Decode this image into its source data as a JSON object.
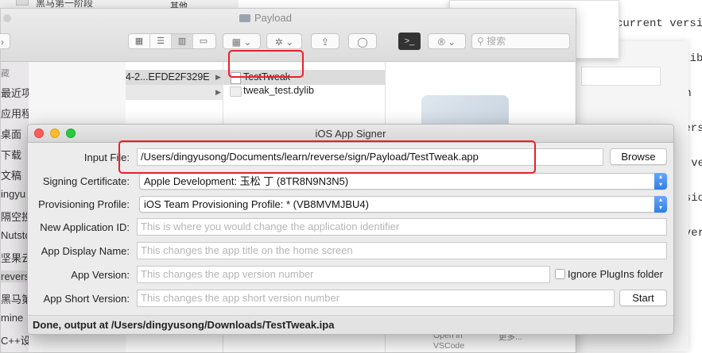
{
  "background": {
    "doc_lines": [
      "current versi",
      "mpatib",
      "tion",
      "versi",
      "nt ver",
      "ersio",
      "t ver"
    ],
    "vscode_open": "Open in",
    "vscode_name": "VSCode",
    "vscode_more": "更多..."
  },
  "top_strip": {
    "item1": "黑马第一阶段",
    "item2": "其他"
  },
  "finder": {
    "title": "Payload",
    "search_placeholder": "搜索",
    "sidebar_items": [
      "藏",
      "最近项目",
      "应用程序",
      "桌面",
      "下载",
      "文稿",
      "ingyu",
      "隔空投",
      "Nutsto",
      "坚果云",
      "reverse",
      "黑马第",
      "mine",
      "C++设计模式"
    ],
    "col1_item": "4-2...EFDE2F329E",
    "col2_items": [
      "TestTweak",
      "tweak_test.dylib"
    ]
  },
  "signer": {
    "title": "iOS App Signer",
    "input_file_label": "Input File:",
    "input_file_value": "/Users/dingyusong/Documents/learn/reverse/sign/Payload/TestTweak.app",
    "browse_label": "Browse",
    "signing_cert_label": "Signing Certificate:",
    "signing_cert_value": "Apple Development: 玉松 丁 (8TR8N9N3N5)",
    "prov_profile_label": "Provisioning Profile:",
    "prov_profile_value": "iOS Team Provisioning Profile: * (VB8MVMJBU4)",
    "new_app_id_label": "New Application ID:",
    "new_app_id_placeholder": "This is where you would change the application identifier",
    "display_name_label": "App Display Name:",
    "display_name_placeholder": "This changes the app title on the home screen",
    "app_version_label": "App Version:",
    "app_version_placeholder": "This changes the app version number",
    "ignore_plugins_label": "Ignore PlugIns folder",
    "short_version_label": "App Short Version:",
    "short_version_placeholder": "This changes the app short version number",
    "start_label": "Start",
    "status": "Done, output at /Users/dingyusong/Downloads/TestTweak.ipa"
  }
}
